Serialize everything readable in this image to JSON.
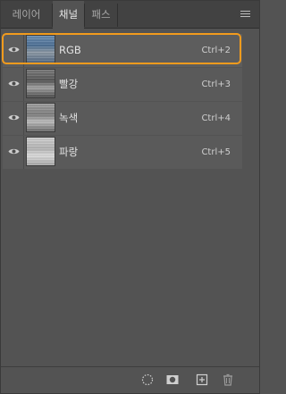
{
  "tabs": [
    {
      "label": "레이어",
      "active": false
    },
    {
      "label": "채널",
      "active": true
    },
    {
      "label": "패스",
      "active": false
    }
  ],
  "channels": [
    {
      "name": "RGB",
      "shortcut": "Ctrl+2",
      "selected": true,
      "thumb": "rgb"
    },
    {
      "name": "빨강",
      "shortcut": "Ctrl+3",
      "selected": false,
      "thumb": "red"
    },
    {
      "name": "녹색",
      "shortcut": "Ctrl+4",
      "selected": false,
      "thumb": "green"
    },
    {
      "name": "파랑",
      "shortcut": "Ctrl+5",
      "selected": false,
      "thumb": "blue"
    }
  ],
  "icons": {
    "panel_menu": "hamburger-menu-icon",
    "visibility": "eye-icon",
    "load_selection": "dotted-circle-icon",
    "save_selection": "mask-icon",
    "new_channel": "add-square-icon",
    "delete_channel": "trash-icon"
  },
  "colors": {
    "panel_bg": "#535353",
    "tab_bar_bg": "#424242",
    "highlight": "#f29b1d"
  }
}
